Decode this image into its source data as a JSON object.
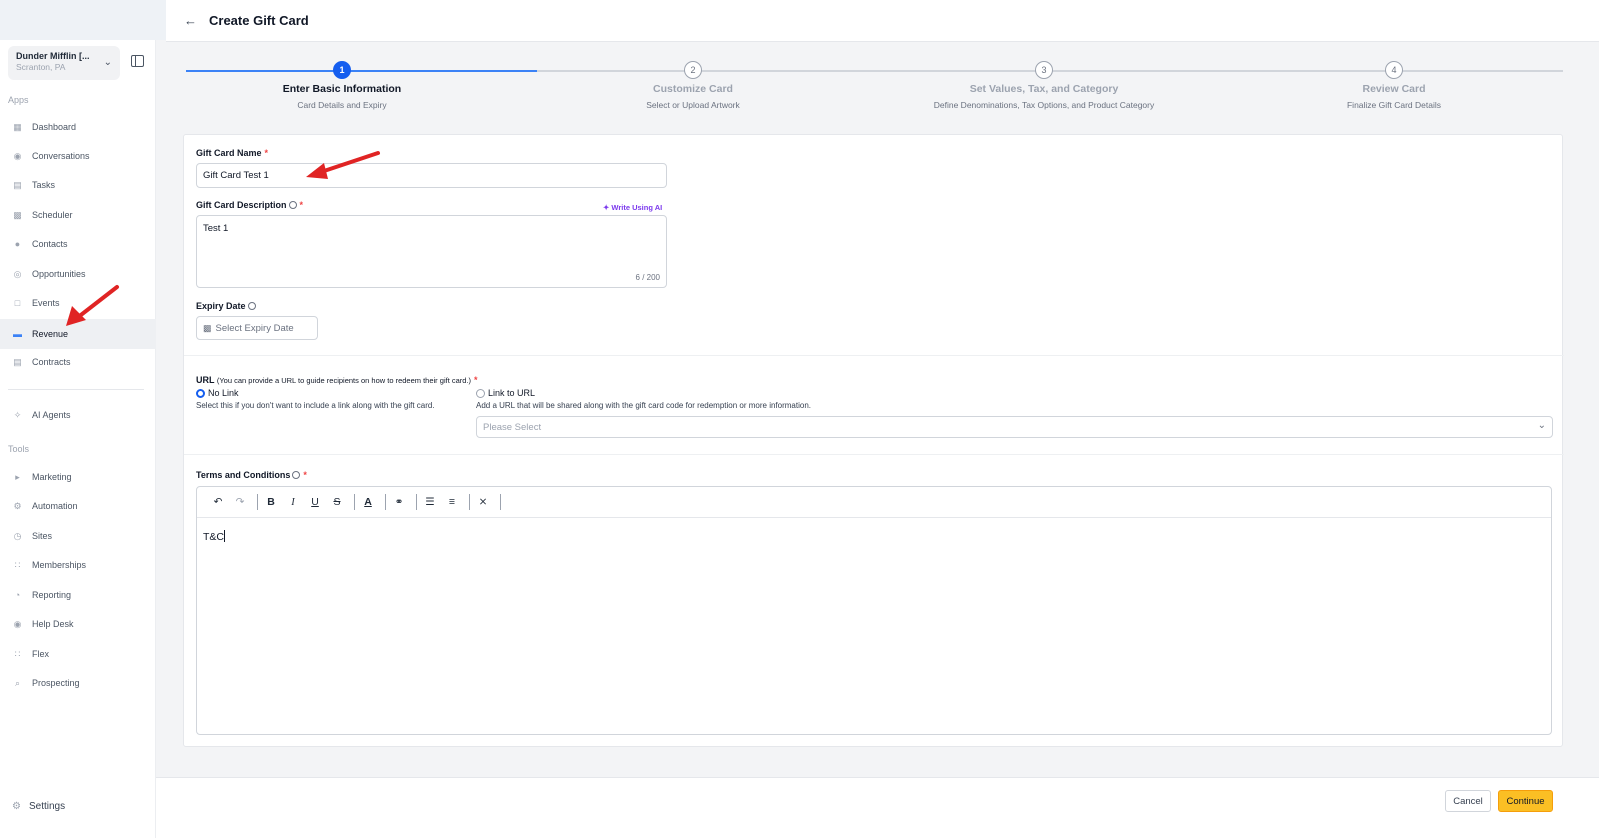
{
  "account": {
    "name": "Dunder Mifflin [...",
    "location": "Scranton, PA"
  },
  "sidebar": {
    "apps_label": "Apps",
    "tools_label": "Tools",
    "items": [
      {
        "label": "Dashboard",
        "icon": "dashboard-icon"
      },
      {
        "label": "Conversations",
        "icon": "chat-icon"
      },
      {
        "label": "Tasks",
        "icon": "task-icon"
      },
      {
        "label": "Scheduler",
        "icon": "calendar-icon"
      },
      {
        "label": "Contacts",
        "icon": "user-icon"
      },
      {
        "label": "Opportunities",
        "icon": "target-icon"
      },
      {
        "label": "Events",
        "icon": "event-icon"
      },
      {
        "label": "Revenue",
        "icon": "card-icon"
      },
      {
        "label": "Contracts",
        "icon": "document-icon"
      }
    ],
    "ai_agents": "AI Agents",
    "tools": [
      {
        "label": "Marketing",
        "icon": "megaphone-icon"
      },
      {
        "label": "Automation",
        "icon": "gears-icon"
      },
      {
        "label": "Sites",
        "icon": "globe-icon"
      },
      {
        "label": "Memberships",
        "icon": "members-icon"
      },
      {
        "label": "Reporting",
        "icon": "pie-chart-icon"
      },
      {
        "label": "Help Desk",
        "icon": "help-icon"
      },
      {
        "label": "Flex",
        "icon": "flex-icon"
      },
      {
        "label": "Prospecting",
        "icon": "search-icon"
      }
    ],
    "settings": "Settings"
  },
  "header": {
    "title": "Create Gift Card"
  },
  "steps": [
    {
      "num": "1",
      "label": "Enter Basic Information",
      "sub": "Card Details and Expiry"
    },
    {
      "num": "2",
      "label": "Customize Card",
      "sub": "Select or Upload Artwork"
    },
    {
      "num": "3",
      "label": "Set Values, Tax, and Category",
      "sub": "Define Denominations, Tax Options, and Product Category"
    },
    {
      "num": "4",
      "label": "Review Card",
      "sub": "Finalize Gift Card Details"
    }
  ],
  "form": {
    "name_label": "Gift Card Name",
    "name_value": "Gift Card Test 1",
    "desc_label": "Gift Card Description",
    "write_ai": "Write Using AI",
    "desc_value": "Test 1",
    "desc_count": "6 / 200",
    "expiry_label": "Expiry Date",
    "expiry_placeholder": "Select Expiry Date",
    "url_label": "URL",
    "url_hint": "(You can provide a URL to guide recipients on how to redeem their gift card.)",
    "no_link": "No Link",
    "no_link_help": "Select this if you don't want to include a link along with the gift card.",
    "link_url": "Link to URL",
    "link_url_help": "Add a URL that will be shared along with the gift card code for redemption or more information.",
    "url_select": "Please Select",
    "terms_label": "Terms and Conditions",
    "terms_value": "T&C",
    "required_mark": "*"
  },
  "footer": {
    "cancel": "Cancel",
    "continue": "Continue"
  },
  "colors": {
    "primary": "#155eef",
    "accent": "#fbbf24",
    "annotation": "#e02424"
  }
}
